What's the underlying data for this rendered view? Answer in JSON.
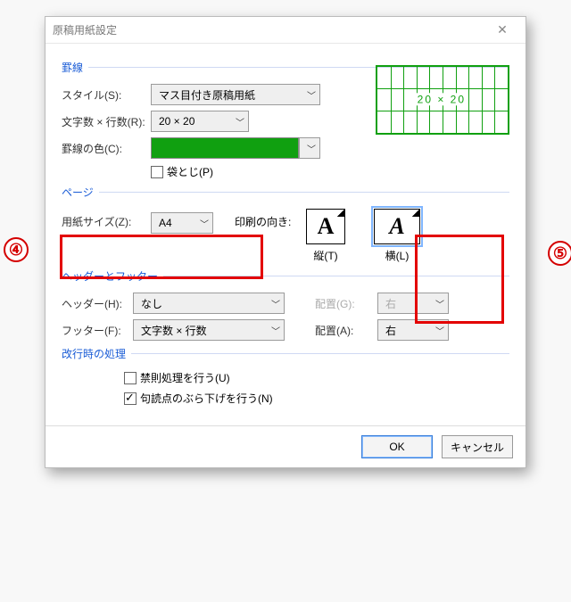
{
  "callouts": {
    "left": "④",
    "right": "⑤"
  },
  "dialog": {
    "title": "原稿用紙設定"
  },
  "sections": {
    "ruled": "罫線",
    "page": "ページ",
    "hf": "ヘッダーとフッター",
    "linebreak": "改行時の処理"
  },
  "ruled": {
    "style_lbl": "スタイル(S):",
    "style_val": "マス目付き原稿用紙",
    "grid_lbl": "文字数 × 行数(R):",
    "grid_val": "20 × 20",
    "color_lbl": "罫線の色(C):",
    "fold_lbl": "袋とじ(P)",
    "preview": "20 × 20"
  },
  "page": {
    "size_lbl": "用紙サイズ(Z):",
    "size_val": "A4",
    "orient_lbl": "印刷の向き:",
    "portrait": "縦(T)",
    "landscape": "横(L)"
  },
  "hf": {
    "header_lbl": "ヘッダー(H):",
    "header_val": "なし",
    "header_align_lbl": "配置(G):",
    "header_align_val": "右",
    "footer_lbl": "フッター(F):",
    "footer_val": "文字数 × 行数",
    "footer_align_lbl": "配置(A):",
    "footer_align_val": "右"
  },
  "linebreak": {
    "kinsoku": "禁則処理を行う(U)",
    "hanging": "句読点のぶら下げを行う(N)"
  },
  "buttons": {
    "ok": "OK",
    "cancel": "キャンセル"
  }
}
